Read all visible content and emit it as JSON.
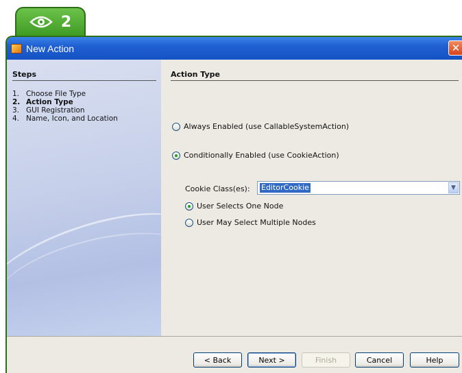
{
  "badge": {
    "icon": "eye-icon",
    "number": "2"
  },
  "window": {
    "title": "New Action",
    "close_glyph": "✕"
  },
  "steps": {
    "heading": "Steps",
    "items": [
      {
        "num": "1.",
        "label": "Choose File Type"
      },
      {
        "num": "2.",
        "label": "Action Type"
      },
      {
        "num": "3.",
        "label": "GUI Registration"
      },
      {
        "num": "4.",
        "label": "Name, Icon, and Location"
      }
    ],
    "current_index": 1
  },
  "content": {
    "heading": "Action Type",
    "always_enabled": {
      "label": "Always Enabled (use CallableSystemAction)",
      "checked": false
    },
    "conditionally_enabled": {
      "label": "Conditionally Enabled (use CookieAction)",
      "checked": true
    },
    "cookie": {
      "label": "Cookie Class(es):",
      "value": "EditorCookie"
    },
    "one_node": {
      "label": "User Selects One Node",
      "checked": true
    },
    "multiple_nodes": {
      "label": "User May Select Multiple Nodes",
      "checked": false
    }
  },
  "buttons": {
    "back": "< Back",
    "next": "Next >",
    "finish": "Finish",
    "cancel": "Cancel",
    "help": "Help"
  },
  "colors": {
    "badge_green": "#4aa82c",
    "titlebar_blue": "#1f5fd1",
    "selection_blue": "#316ac5"
  }
}
